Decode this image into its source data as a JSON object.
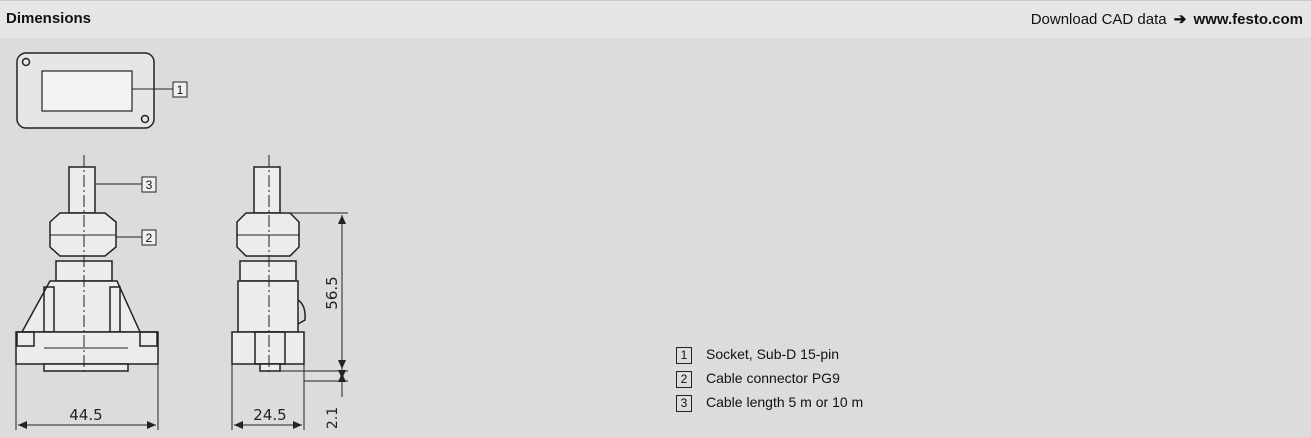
{
  "header": {
    "title": "Dimensions",
    "download_label": "Download CAD data",
    "download_arrow": "➔",
    "download_url": "www.festo.com"
  },
  "callouts": {
    "c1": "1",
    "c2": "2",
    "c3": "3"
  },
  "dimensions": {
    "width_front": "44.5",
    "width_side": "24.5",
    "height": "56.5",
    "offset": "2.1"
  },
  "legend": [
    {
      "number": "1",
      "text": "Socket, Sub-D 15-pin"
    },
    {
      "number": "2",
      "text": "Cable connector PG9"
    },
    {
      "number": "3",
      "text": "Cable length 5 m or 10 m"
    }
  ]
}
